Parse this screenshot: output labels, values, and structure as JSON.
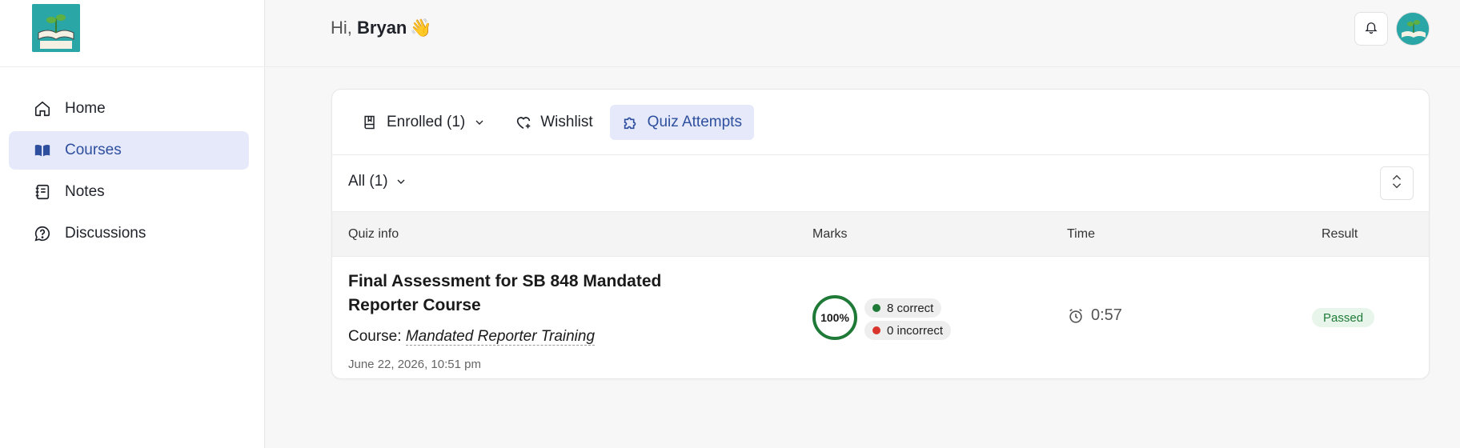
{
  "header": {
    "greeting_prefix": "Hi,",
    "user_name": "Bryan",
    "wave_emoji": "👋"
  },
  "sidebar": {
    "items": [
      {
        "label": "Home",
        "icon": "home-icon",
        "active": false
      },
      {
        "label": "Courses",
        "icon": "book-open-icon",
        "active": true
      },
      {
        "label": "Notes",
        "icon": "notes-icon",
        "active": false
      },
      {
        "label": "Discussions",
        "icon": "question-bubble-icon",
        "active": false
      }
    ]
  },
  "tabs": [
    {
      "label": "Enrolled (1)",
      "icon": "book-icon",
      "active": false,
      "has_dropdown": true
    },
    {
      "label": "Wishlist",
      "icon": "heart-plus-icon",
      "active": false,
      "has_dropdown": false
    },
    {
      "label": "Quiz Attempts",
      "icon": "puzzle-icon",
      "active": true,
      "has_dropdown": false
    }
  ],
  "filter": {
    "label": "All (1)"
  },
  "table": {
    "columns": [
      "Quiz info",
      "Marks",
      "Time",
      "Result"
    ],
    "rows": [
      {
        "title": "Final Assessment for SB 848 Mandated Reporter Course",
        "course_prefix": "Course:",
        "course_name": "Mandated Reporter Training",
        "date": "June 22, 2026, 10:51 pm",
        "score_percent": "100%",
        "correct": "8 correct",
        "incorrect": "0 incorrect",
        "time": "0:57",
        "result": "Passed"
      }
    ]
  },
  "colors": {
    "accent": "#2e4f9e",
    "active_bg": "#e5e9fa",
    "success": "#1f7a37",
    "success_bg": "#e7f5ea",
    "error_dot": "#d9342b"
  }
}
